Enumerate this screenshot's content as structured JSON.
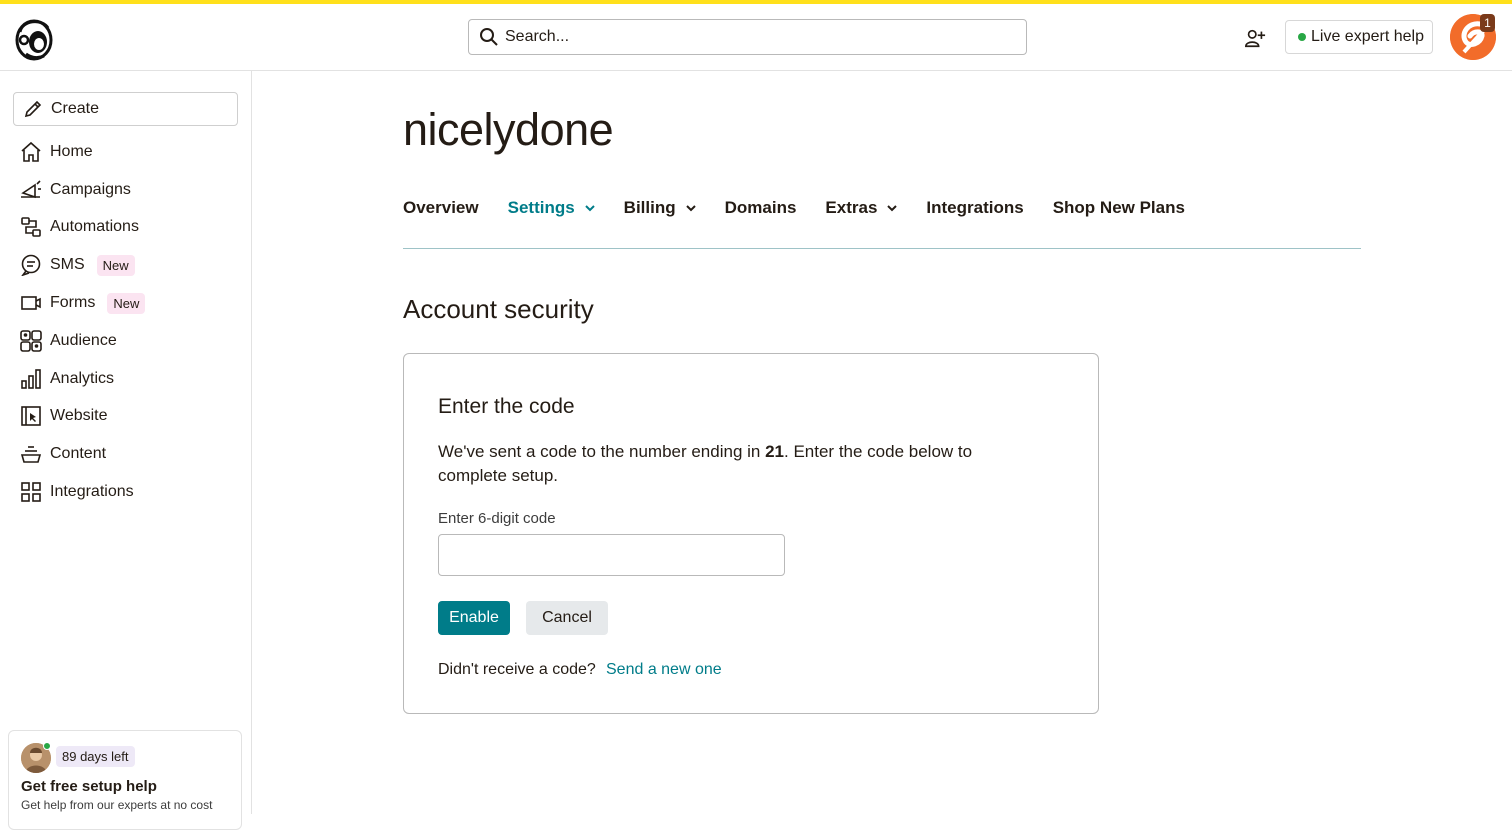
{
  "header": {
    "search_placeholder": "Search...",
    "live_help_label": "Live expert help",
    "notification_count": "1"
  },
  "sidebar": {
    "create_label": "Create",
    "items": [
      {
        "label": "Home",
        "icon": "home-icon"
      },
      {
        "label": "Campaigns",
        "icon": "megaphone-icon"
      },
      {
        "label": "Automations",
        "icon": "automation-icon"
      },
      {
        "label": "SMS",
        "icon": "sms-icon",
        "badge": "New"
      },
      {
        "label": "Forms",
        "icon": "form-icon",
        "badge": "New"
      },
      {
        "label": "Audience",
        "icon": "audience-icon"
      },
      {
        "label": "Analytics",
        "icon": "analytics-icon"
      },
      {
        "label": "Website",
        "icon": "website-icon"
      },
      {
        "label": "Content",
        "icon": "content-icon"
      },
      {
        "label": "Integrations",
        "icon": "integrations-icon"
      }
    ],
    "help_card": {
      "days_left": "89 days left",
      "title": "Get free setup help",
      "subtitle": "Get help from our experts at no cost"
    }
  },
  "main": {
    "account_name": "nicelydone",
    "tabs": [
      {
        "label": "Overview",
        "dropdown": false
      },
      {
        "label": "Settings",
        "dropdown": true,
        "active": true
      },
      {
        "label": "Billing",
        "dropdown": true
      },
      {
        "label": "Domains",
        "dropdown": false
      },
      {
        "label": "Extras",
        "dropdown": true
      },
      {
        "label": "Integrations",
        "dropdown": false
      },
      {
        "label": "Shop New Plans",
        "dropdown": false
      }
    ],
    "section_title": "Account security",
    "card": {
      "title": "Enter the code",
      "text_before": "We've sent a code to the number ending in ",
      "number_suffix": "21",
      "text_after": ". Enter the code below to complete setup.",
      "field_label": "Enter 6-digit code",
      "field_value": "",
      "enable_label": "Enable",
      "cancel_label": "Cancel",
      "resend_question": "Didn't receive a code?",
      "resend_link": "Send a new one"
    }
  },
  "colors": {
    "accent": "#007c89",
    "top_stripe": "#ffe01b",
    "new_badge_bg": "#fbe4f1"
  }
}
